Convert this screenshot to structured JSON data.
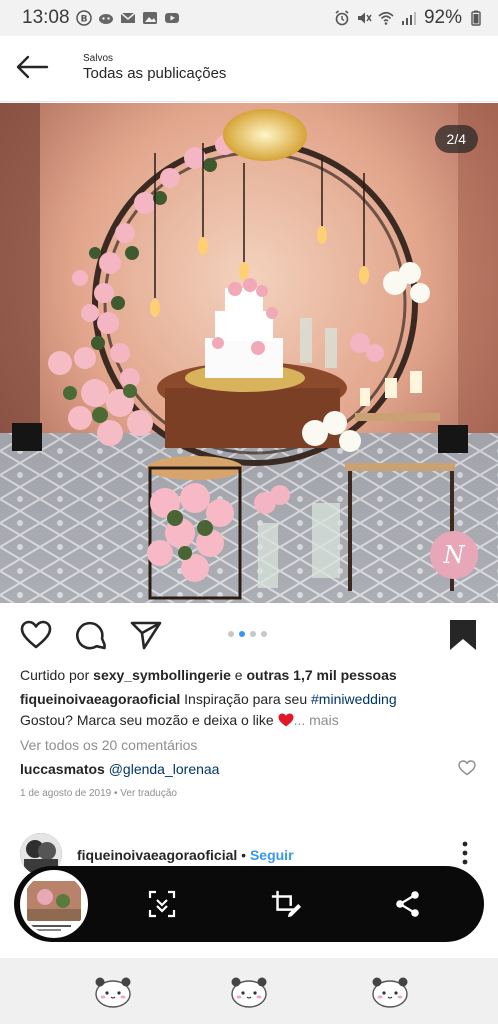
{
  "status_bar": {
    "time": "13:08",
    "battery": "92%"
  },
  "header": {
    "subtitle": "Salvos",
    "title": "Todas as publicações"
  },
  "post": {
    "page_counter": "2/4",
    "carousel_total": 4,
    "carousel_active": 2,
    "liked_by_prefix": "Curtido por ",
    "liked_by_user": "sexy_symbollingerie",
    "liked_by_and": " e ",
    "liked_by_others": "outras 1,7 mil pessoas",
    "caption_user": "fiqueinoivaeagoraoficial",
    "caption_text_1": " Inspiração para seu ",
    "caption_hashtag": "#miniwedding",
    "caption_text_2": "Gostou? Marca seu mozão e deixa o like ",
    "caption_more": "... mais",
    "view_comments": "Ver todos os 20 comentários",
    "comment_user": "luccasmatos",
    "comment_mention": "@glenda_lorenaa",
    "date": "1 de agosto de 2019",
    "date_separator": " • ",
    "translate": "Ver tradução"
  },
  "next_post": {
    "user": "fiqueinoivaeagoraoficial",
    "separator": " • ",
    "follow": "Seguir"
  },
  "colors": {
    "link": "#003569",
    "follow": "#3897f0",
    "muted": "#8e8e8e",
    "toolbar_bg": "#0a0a0a"
  },
  "icons": {
    "back": "arrow-left-icon",
    "like": "heart-outline-icon",
    "comment": "comment-bubble-icon",
    "share": "paper-plane-icon",
    "save": "bookmark-filled-icon",
    "expand": "scroll-capture-icon",
    "crop": "crop-edit-icon",
    "share_screenshot": "share-icon"
  }
}
